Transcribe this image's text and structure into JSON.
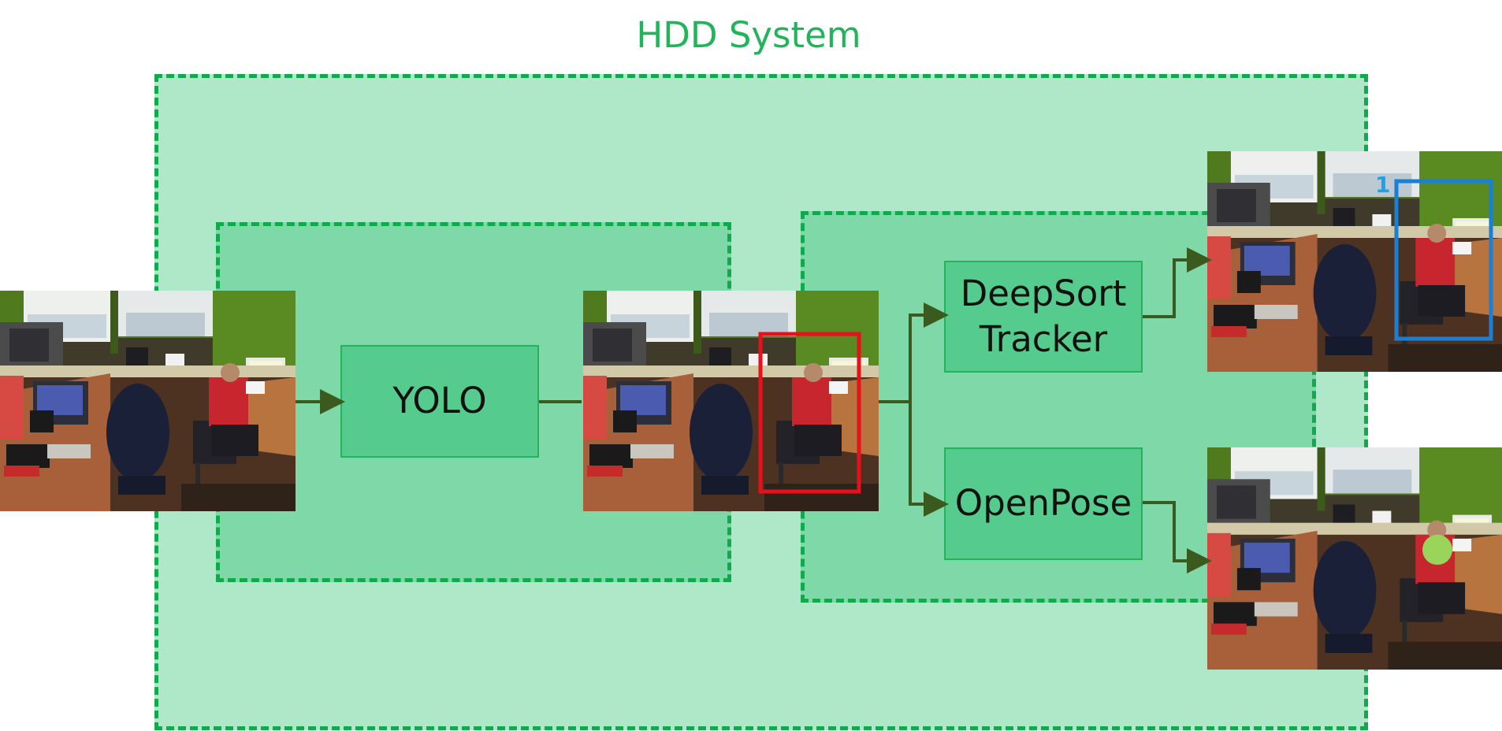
{
  "title": "HDD System",
  "modules": {
    "yolo": "YOLO",
    "deepsort": "DeepSort\nTracker",
    "openpose": "OpenPose"
  },
  "tracker_output": {
    "track_id": "1"
  },
  "colors": {
    "title": "#21b45a",
    "zone_border": "#10aa4c",
    "outer_zone": "#afe8c9",
    "inner_zone": "#7fd8a8",
    "module_fill": "#55cc8d",
    "arrow": "#3a5a1e",
    "detection_box": "#e8101a",
    "track_box": "#1a7fd6",
    "track_id": "#1aa3e8",
    "keypoint": "#9bd45a"
  }
}
